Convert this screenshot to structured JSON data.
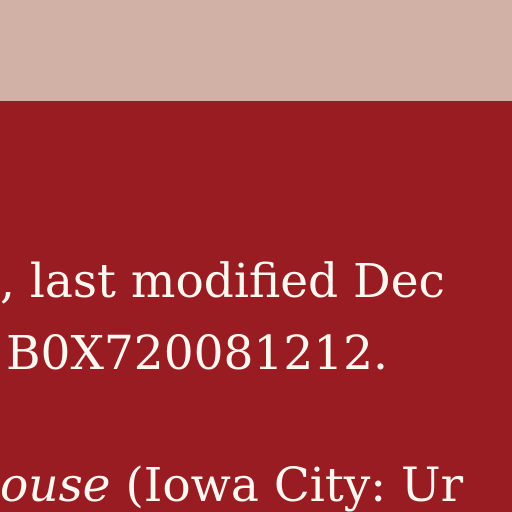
{
  "document": {
    "line1": ", last modified Dec",
    "line2": "B0X720081212.",
    "line3_italic": "ouse",
    "line3_rest": " (Iowa City: Ur"
  },
  "colors": {
    "top_band": "#d1b1a5",
    "background": "#981c21",
    "text": "#fff8f0"
  }
}
